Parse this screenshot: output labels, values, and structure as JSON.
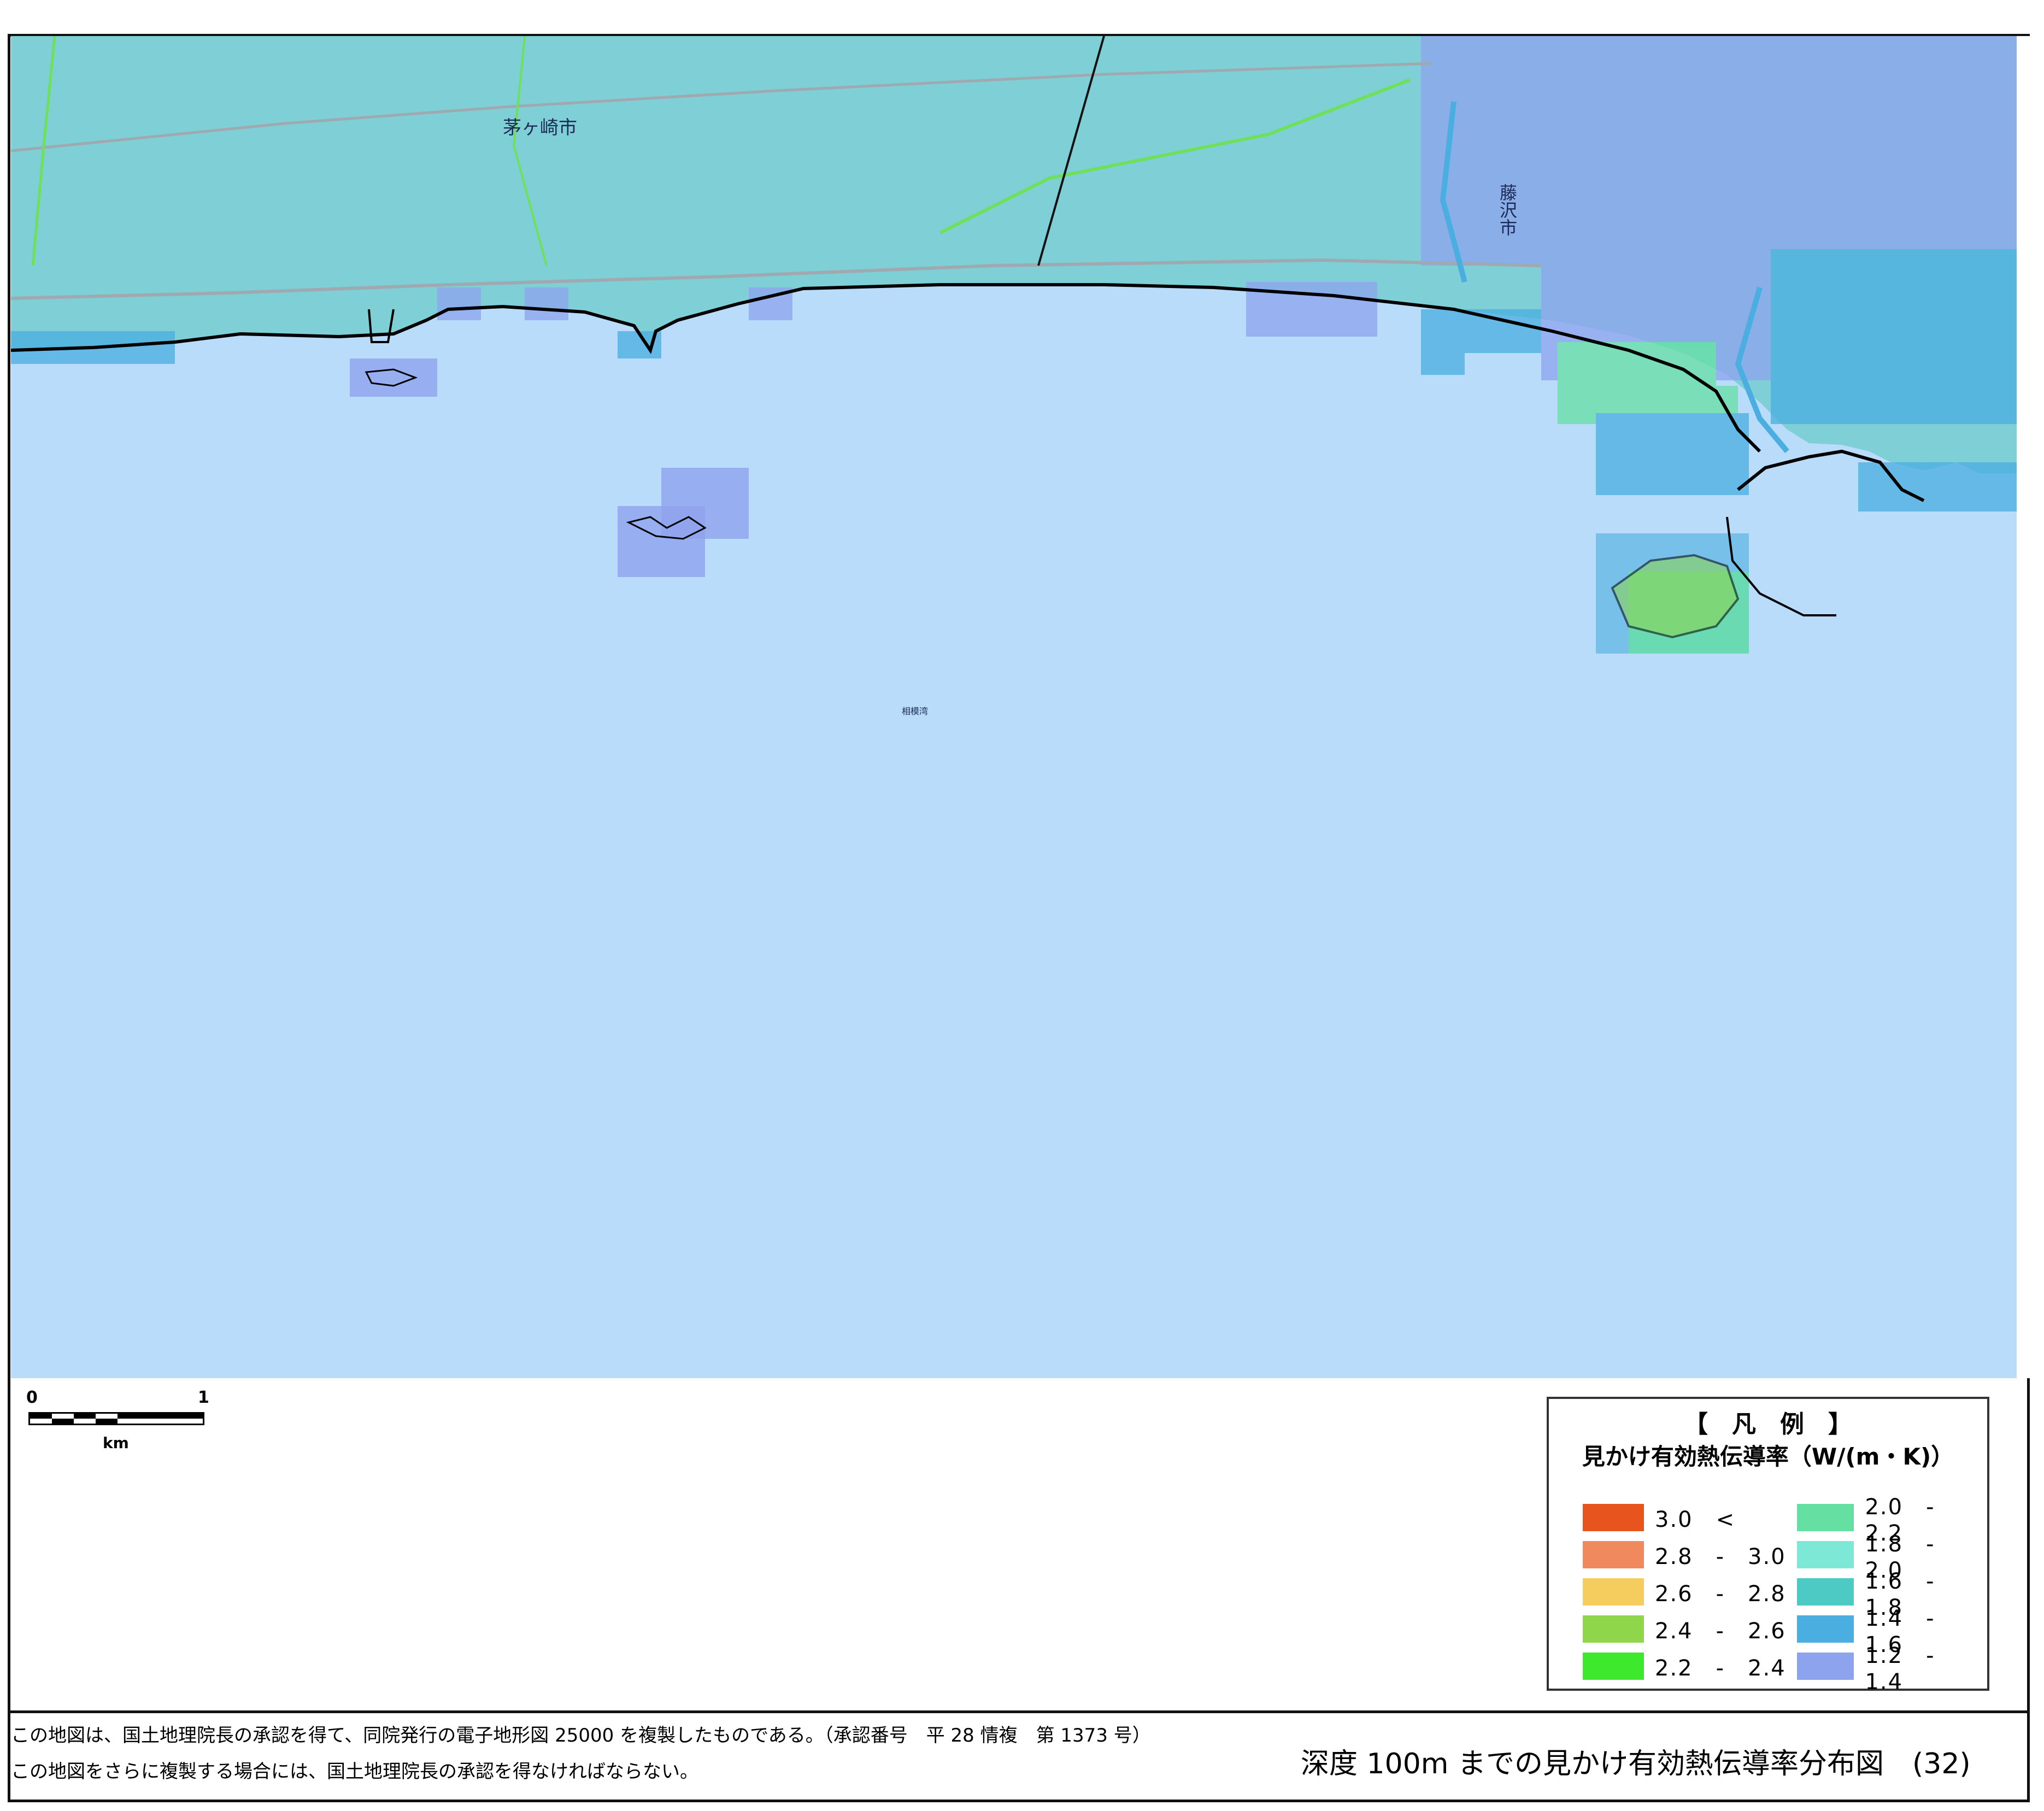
{
  "map": {
    "places": [
      "茅ヶ崎市",
      "藤沢市",
      "相模湾"
    ],
    "colors": {
      "sea": "#b9dcfb",
      "land": "#7ecfd6",
      "coast": "#000000"
    }
  },
  "scalebar": {
    "tick_start": "0",
    "tick_end": "1",
    "unit": "km"
  },
  "legend": {
    "title": "【　凡　例　】",
    "subtitle": "見かけ有効熱伝導率（W/(m・K)）",
    "items": [
      {
        "label": "3.0　<",
        "color": "#e8541e"
      },
      {
        "label": "2.8　-　3.0",
        "color": "#f08a5e"
      },
      {
        "label": "2.6　-　2.8",
        "color": "#f5cd5f"
      },
      {
        "label": "2.4　-　2.6",
        "color": "#8fd64a"
      },
      {
        "label": "2.2　-　2.4",
        "color": "#3ee82c"
      },
      {
        "label": "2.0　-　2.2",
        "color": "#66e0a2"
      },
      {
        "label": "1.8　-　2.0",
        "color": "#7ee8d6"
      },
      {
        "label": "1.6　-　1.8",
        "color": "#4ecac4"
      },
      {
        "label": "1.4　-　1.6",
        "color": "#4aaee0"
      },
      {
        "label": "1.2　-　1.4",
        "color": "#8ea3ee"
      }
    ]
  },
  "footer": {
    "note1": "この地図は、国土地理院長の承認を得て、同院発行の電子地形図 25000 を複製したものである。（承認番号　平 28 情複　第 1373 号）",
    "note2": "この地図をさらに複製する場合には、国土地理院長の承認を得なければならない。",
    "title": "深度 100m までの見かけ有効熱伝導率分布図　(32)"
  }
}
